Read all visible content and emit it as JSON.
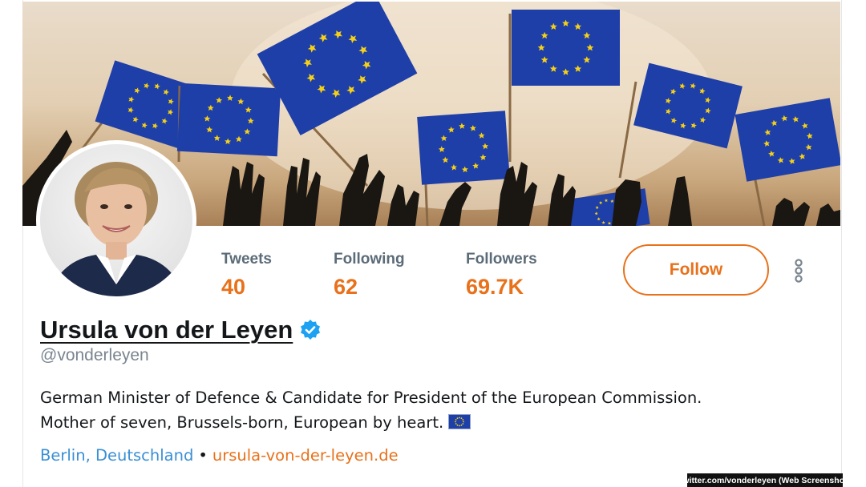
{
  "profile": {
    "display_name": "Ursula von der Leyen",
    "handle": "@vonderleyen",
    "verified": true,
    "bio_line1": "German Minister of Defence & Candidate for President of the European Commission.",
    "bio_line2": "Mother of seven, Brussels-born, European by heart.",
    "location": "Berlin, Deutschland",
    "separator": "•",
    "website": "ursula-von-der-leyen.de"
  },
  "stats": {
    "tweets_label": "Tweets",
    "tweets_value": "40",
    "following_label": "Following",
    "following_value": "62",
    "followers_label": "Followers",
    "followers_value": "69.7K"
  },
  "actions": {
    "follow_label": "Follow",
    "more_icon": "more-vertical-icon"
  },
  "caption": "twitter.com/vonderleyen (Web Screenshot)",
  "colors": {
    "accent": "#e8711a",
    "link_blue": "#3a8fd4",
    "verified_blue": "#1da1f2",
    "eu_blue": "#1f3fa8",
    "eu_star": "#f4d018"
  }
}
